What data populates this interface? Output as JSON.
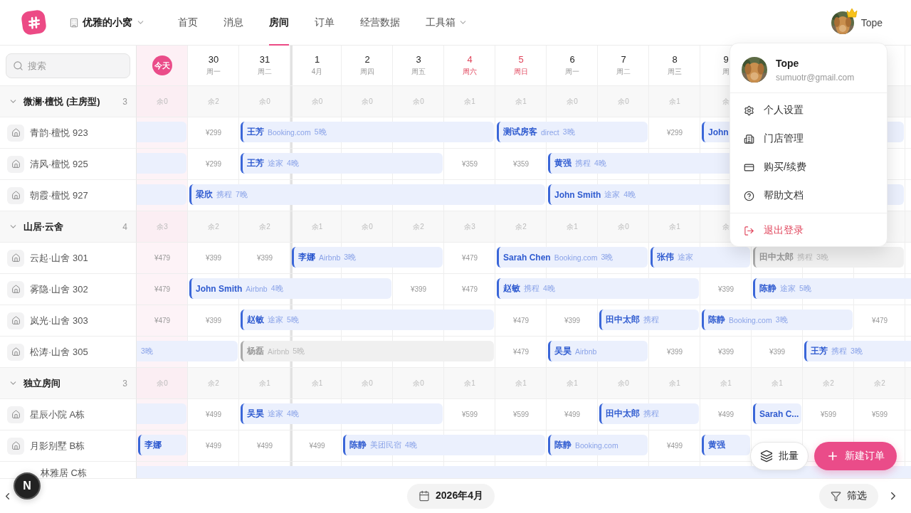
{
  "nav": {
    "store": "优雅的小窝",
    "items": [
      {
        "label": "首页",
        "selected": false
      },
      {
        "label": "消息",
        "selected": false
      },
      {
        "label": "房间",
        "selected": true
      },
      {
        "label": "订单",
        "selected": false
      },
      {
        "label": "经营数据",
        "selected": false
      },
      {
        "label": "工具箱",
        "selected": false,
        "kind": "menu"
      }
    ]
  },
  "user": {
    "name": "Tope"
  },
  "menu": {
    "name": "Tope",
    "email": "sumuotr@gmail.com",
    "items": [
      {
        "label": "个人设置",
        "kind": "settings",
        "danger": false
      },
      {
        "label": "门店管理",
        "kind": "store",
        "danger": false
      },
      {
        "label": "购买/续费",
        "kind": "billing",
        "danger": false
      },
      {
        "label": "帮助文档",
        "kind": "help",
        "danger": false
      },
      {
        "label": "退出登录",
        "kind": "logout",
        "danger": true
      }
    ]
  },
  "search": {
    "placeholder": "搜索"
  },
  "columns": [
    {
      "kind": "today",
      "label": "今天"
    },
    {
      "kind": "day",
      "date": "30",
      "sub": "周一",
      "weekend": false
    },
    {
      "kind": "day",
      "date": "31",
      "sub": "周二",
      "weekend": false
    },
    {
      "kind": "month_start",
      "date": "1",
      "sub": "4月",
      "weekend": false
    },
    {
      "kind": "day",
      "date": "2",
      "sub": "周四",
      "weekend": false
    },
    {
      "kind": "day",
      "date": "3",
      "sub": "周五",
      "weekend": false
    },
    {
      "kind": "day",
      "date": "4",
      "sub": "周六",
      "weekend": true
    },
    {
      "kind": "day",
      "date": "5",
      "sub": "周日",
      "weekend": true
    },
    {
      "kind": "day",
      "date": "6",
      "sub": "周一",
      "weekend": false
    },
    {
      "kind": "day",
      "date": "7",
      "sub": "周二",
      "weekend": false
    },
    {
      "kind": "day",
      "date": "8",
      "sub": "周三",
      "weekend": false
    },
    {
      "kind": "day",
      "date": "9",
      "sub": "周",
      "weekend": false
    }
  ],
  "groups": [
    {
      "name": "微澜·檀悦 (主房型)",
      "count": "3",
      "expanded": true,
      "availability": [
        "余0",
        "余2",
        "余0",
        "余0",
        "余0",
        "余0",
        "余1",
        "余1",
        "余0",
        "余0",
        "余1",
        "余"
      ],
      "rooms": [
        {
          "name": "青韵·檀悦 923",
          "cells": [
            {
              "kind": "booking",
              "continued": true,
              "muted": false
            },
            {
              "kind": "price",
              "text": "¥299"
            },
            {
              "kind": "booking",
              "guest": "王芳",
              "source": "Booking.com",
              "nights": "5晚",
              "muted": false
            },
            {
              "kind": "cont"
            },
            {
              "kind": "cont"
            },
            {
              "kind": "cont"
            },
            {
              "kind": "cont"
            },
            {
              "kind": "booking",
              "guest": "测试房客",
              "source": "direct",
              "nights": "3晚",
              "muted": false
            },
            {
              "kind": "cont"
            },
            {
              "kind": "cont"
            },
            {
              "kind": "price",
              "text": "¥299"
            },
            {
              "kind": "booking",
              "guest": "John",
              "muted": false
            },
            {
              "kind": "cont"
            },
            {
              "kind": "cont"
            },
            {
              "kind": "cont"
            }
          ]
        },
        {
          "name": "清风·檀悦 925",
          "cells": [
            {
              "kind": "booking",
              "continued": true,
              "muted": false
            },
            {
              "kind": "price",
              "text": "¥299"
            },
            {
              "kind": "booking",
              "guest": "王芳",
              "source": "途家",
              "nights": "4晚",
              "muted": false
            },
            {
              "kind": "cont"
            },
            {
              "kind": "cont"
            },
            {
              "kind": "cont"
            },
            {
              "kind": "price",
              "text": "¥359"
            },
            {
              "kind": "price",
              "text": "¥359"
            },
            {
              "kind": "booking",
              "guest": "黄强",
              "source": "携程",
              "nights": "4晚",
              "muted": false
            },
            {
              "kind": "cont"
            },
            {
              "kind": "cont"
            },
            {
              "kind": "cont"
            }
          ]
        },
        {
          "name": "朝霞·檀悦 927",
          "cells": [
            {
              "kind": "booking",
              "continued": true,
              "muted": false
            },
            {
              "kind": "booking",
              "guest": "梁欣",
              "source": "携程",
              "nights": "7晚",
              "muted": false
            },
            {
              "kind": "cont"
            },
            {
              "kind": "cont"
            },
            {
              "kind": "cont"
            },
            {
              "kind": "cont"
            },
            {
              "kind": "cont"
            },
            {
              "kind": "cont"
            },
            {
              "kind": "booking",
              "guest": "John Smith",
              "source": "途家",
              "nights": "4晚",
              "muted": false
            },
            {
              "kind": "cont"
            },
            {
              "kind": "cont"
            },
            {
              "kind": "cont"
            },
            {
              "kind": "cont"
            },
            {
              "kind": "cont"
            },
            {
              "kind": "cont"
            }
          ]
        }
      ]
    },
    {
      "name": "山居·云舍",
      "count": "4",
      "expanded": true,
      "availability": [
        "余3",
        "余2",
        "余2",
        "余1",
        "余0",
        "余2",
        "余3",
        "余2",
        "余1",
        "余0",
        "余1",
        "余"
      ],
      "rooms": [
        {
          "name": "云起·山舍 301",
          "cells": [
            {
              "kind": "price",
              "text": "¥479"
            },
            {
              "kind": "price",
              "text": "¥399"
            },
            {
              "kind": "price",
              "text": "¥399"
            },
            {
              "kind": "booking",
              "guest": "李娜",
              "source": "Airbnb",
              "nights": "3晚",
              "muted": false
            },
            {
              "kind": "cont"
            },
            {
              "kind": "cont"
            },
            {
              "kind": "price",
              "text": "¥479"
            },
            {
              "kind": "booking",
              "guest": "Sarah Chen",
              "source": "Booking.com",
              "nights": "3晚",
              "muted": false
            },
            {
              "kind": "cont"
            },
            {
              "kind": "cont"
            },
            {
              "kind": "booking",
              "guest": "张伟",
              "source": "途家",
              "muted": false
            },
            {
              "kind": "cont"
            },
            {
              "kind": "booking",
              "guest": "田中太郎",
              "source": "携程",
              "nights": "3晚",
              "muted": true
            },
            {
              "kind": "cont"
            },
            {
              "kind": "cont"
            }
          ]
        },
        {
          "name": "雾隐·山舍 302",
          "cells": [
            {
              "kind": "price",
              "text": "¥479"
            },
            {
              "kind": "booking",
              "guest": "John Smith",
              "source": "Airbnb",
              "nights": "4晚",
              "muted": false
            },
            {
              "kind": "cont"
            },
            {
              "kind": "cont"
            },
            {
              "kind": "cont"
            },
            {
              "kind": "price",
              "text": "¥399"
            },
            {
              "kind": "price",
              "text": "¥479"
            },
            {
              "kind": "booking",
              "guest": "赵敏",
              "source": "携程",
              "nights": "4晚",
              "muted": false
            },
            {
              "kind": "cont"
            },
            {
              "kind": "cont"
            },
            {
              "kind": "cont"
            },
            {
              "kind": "price",
              "text": "¥399"
            },
            {
              "kind": "booking",
              "guest": "陈静",
              "source": "途家",
              "nights": "5晚",
              "muted": false
            },
            {
              "kind": "cont"
            },
            {
              "kind": "cont"
            },
            {
              "kind": "cont"
            }
          ]
        },
        {
          "name": "岚光·山舍 303",
          "cells": [
            {
              "kind": "price",
              "text": "¥479"
            },
            {
              "kind": "price",
              "text": "¥399"
            },
            {
              "kind": "booking",
              "guest": "赵敏",
              "source": "途家",
              "nights": "5晚",
              "muted": false
            },
            {
              "kind": "cont"
            },
            {
              "kind": "cont"
            },
            {
              "kind": "cont"
            },
            {
              "kind": "cont"
            },
            {
              "kind": "price",
              "text": "¥479"
            },
            {
              "kind": "price",
              "text": "¥399"
            },
            {
              "kind": "booking",
              "guest": "田中太郎",
              "source": "携程",
              "muted": false
            },
            {
              "kind": "cont"
            },
            {
              "kind": "booking",
              "guest": "陈静",
              "source": "Booking.com",
              "nights": "3晚",
              "muted": false
            },
            {
              "kind": "cont"
            },
            {
              "kind": "cont"
            },
            {
              "kind": "price",
              "text": "¥479"
            }
          ]
        },
        {
          "name": "松涛·山舍 305",
          "cells": [
            {
              "kind": "booking",
              "continued": true,
              "nights": "3晚",
              "muted": false
            },
            {
              "kind": "cont"
            },
            {
              "kind": "booking",
              "guest": "杨磊",
              "source": "Airbnb",
              "nights": "5晚",
              "muted": true
            },
            {
              "kind": "cont"
            },
            {
              "kind": "cont"
            },
            {
              "kind": "cont"
            },
            {
              "kind": "cont"
            },
            {
              "kind": "price",
              "text": "¥479"
            },
            {
              "kind": "booking",
              "guest": "吴昊",
              "source": "Airbnb",
              "muted": false
            },
            {
              "kind": "cont"
            },
            {
              "kind": "price",
              "text": "¥399"
            },
            {
              "kind": "price",
              "text": "¥399"
            },
            {
              "kind": "price",
              "text": "¥399"
            },
            {
              "kind": "booking",
              "guest": "王芳",
              "source": "携程",
              "nights": "3晚",
              "muted": false
            },
            {
              "kind": "cont"
            },
            {
              "kind": "cont"
            }
          ]
        }
      ]
    },
    {
      "name": "独立房间",
      "count": "3",
      "expanded": true,
      "availability": [
        "余0",
        "余2",
        "余1",
        "余1",
        "余0",
        "余0",
        "余1",
        "余1",
        "余1",
        "余0",
        "余1",
        "余1",
        "余1",
        "余2",
        "余2"
      ],
      "rooms": [
        {
          "name": "星辰小院 A栋",
          "cells": [
            {
              "kind": "booking",
              "continued": true,
              "muted": false
            },
            {
              "kind": "price",
              "text": "¥499"
            },
            {
              "kind": "booking",
              "guest": "吴昊",
              "source": "途家",
              "nights": "4晚",
              "muted": false
            },
            {
              "kind": "cont"
            },
            {
              "kind": "cont"
            },
            {
              "kind": "cont"
            },
            {
              "kind": "price",
              "text": "¥599"
            },
            {
              "kind": "price",
              "text": "¥599"
            },
            {
              "kind": "price",
              "text": "¥499"
            },
            {
              "kind": "booking",
              "guest": "田中太郎",
              "source": "携程",
              "muted": false
            },
            {
              "kind": "cont"
            },
            {
              "kind": "price",
              "text": "¥499"
            },
            {
              "kind": "booking",
              "guest": "Sarah C...",
              "muted": false
            },
            {
              "kind": "price",
              "text": "¥599"
            },
            {
              "kind": "price",
              "text": "¥599"
            }
          ]
        },
        {
          "name": "月影别墅 B栋",
          "cells": [
            {
              "kind": "booking",
              "guest": "李娜",
              "muted": false
            },
            {
              "kind": "price",
              "text": "¥499"
            },
            {
              "kind": "price",
              "text": "¥499"
            },
            {
              "kind": "price",
              "text": "¥499"
            },
            {
              "kind": "booking",
              "guest": "陈静",
              "source": "美团民宿",
              "nights": "4晚",
              "muted": false
            },
            {
              "kind": "cont"
            },
            {
              "kind": "cont"
            },
            {
              "kind": "cont"
            },
            {
              "kind": "booking",
              "guest": "陈静",
              "source": "Booking.com",
              "muted": false
            },
            {
              "kind": "cont"
            },
            {
              "kind": "price",
              "text": "¥499"
            },
            {
              "kind": "booking",
              "guest": "黄强",
              "muted": false
            }
          ]
        },
        {
          "name": "林雅居 C栋",
          "kind": "partial",
          "cells": [
            {
              "kind": "booking",
              "continued": true,
              "muted": false
            },
            {
              "kind": "cont"
            },
            {
              "kind": "cont"
            },
            {
              "kind": "cont"
            },
            {
              "kind": "cont"
            },
            {
              "kind": "cont"
            },
            {
              "kind": "cont"
            },
            {
              "kind": "cont"
            },
            {
              "kind": "cont"
            },
            {
              "kind": "cont"
            },
            {
              "kind": "cont"
            },
            {
              "kind": "cont"
            },
            {
              "kind": "cont"
            },
            {
              "kind": "cont"
            },
            {
              "kind": "cont"
            },
            {
              "kind": "cont"
            }
          ]
        }
      ]
    }
  ],
  "actions": [
    {
      "label": "批量",
      "kind": "batch",
      "primary": false
    },
    {
      "label": "新建订单",
      "kind": "new",
      "primary": true
    }
  ],
  "footer": {
    "month": "2026年4月",
    "filter": "筛选"
  },
  "dev_indicator": {
    "label": "N"
  }
}
